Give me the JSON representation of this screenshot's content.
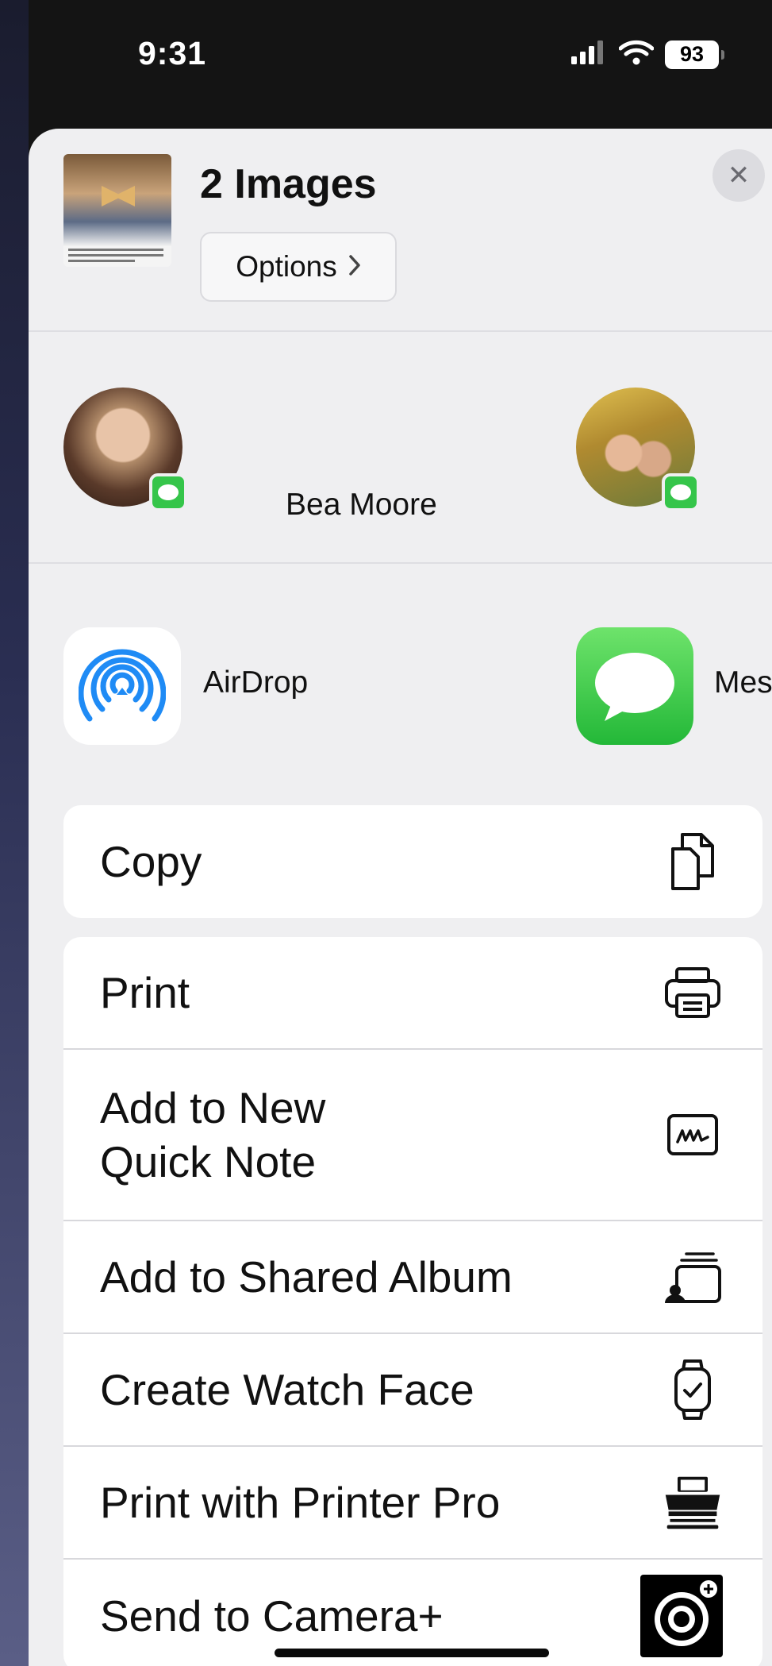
{
  "status_bar": {
    "time": "9:31",
    "battery": "93"
  },
  "header": {
    "title": "2 Images",
    "options_label": "Options",
    "close_symbol": "✕"
  },
  "people": [
    {
      "name": ""
    },
    {
      "name": "Bea Moore"
    }
  ],
  "apps": [
    {
      "label": "AirDrop"
    },
    {
      "label": "Mes"
    }
  ],
  "actions": {
    "copy": "Copy",
    "print": "Print",
    "quick_note_line1": "Add to New",
    "quick_note_line2": "Quick Note",
    "shared_album": "Add to Shared Album",
    "watch_face": "Create Watch Face",
    "printer_pro": "Print with Printer Pro",
    "camera_plus": "Send to Camera+"
  },
  "icons": {
    "copy": "copy-icon",
    "print": "printer-icon",
    "quick_note": "quick-note-icon",
    "shared_album": "shared-album-icon",
    "watch_face": "watch-icon",
    "printer_pro": "printer-pro-icon",
    "camera_plus": "camera-plus-icon",
    "airdrop": "airdrop-icon",
    "messages": "messages-icon"
  },
  "colors": {
    "messages_green": "#35c54a",
    "airdrop_blue": "#1f8bf5",
    "sheet_bg": "#efeff1"
  }
}
